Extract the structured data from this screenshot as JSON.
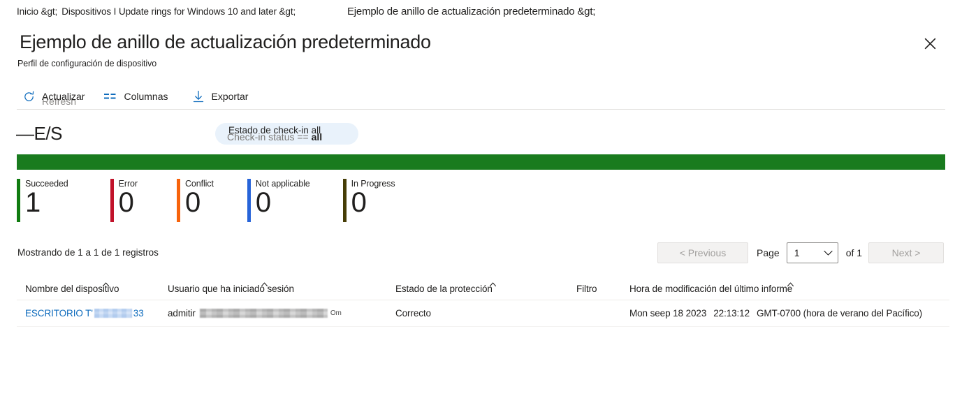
{
  "breadcrumb": {
    "item1": "Inicio &gt;",
    "item2": "Dispositivos I Update rings for Windows 10 and later &gt;",
    "item3": "Ejemplo de anillo de actualización predeterminado &gt;"
  },
  "header": {
    "title": "Ejemplo de anillo de actualización predeterminado",
    "subtitle": "Perfil de configuración de dispositivo",
    "close_icon": "close-icon"
  },
  "toolbar": {
    "refresh_label_es": "Actualizar",
    "refresh_label_en": "Refresh",
    "refresh_icon": "refresh-icon",
    "columns_label": "Columnas",
    "columns_icon": "columns-icon",
    "export_label": "Exportar",
    "export_icon": "download-icon"
  },
  "section": {
    "heading": "—E/S",
    "filter_pill_es": "Estado de check-in all",
    "filter_pill_en_prefix": "Check-in status ==",
    "filter_pill_en_value": "all"
  },
  "status": {
    "bar_color": "#197b1e",
    "tiles": [
      {
        "label": "Succeeded",
        "value": "1",
        "color": "#107c10"
      },
      {
        "label": "Error",
        "value": "0",
        "color": "#c1122a"
      },
      {
        "label": "Conflict",
        "value": "0",
        "color": "#f7630c"
      },
      {
        "label": "Not applicable",
        "value": "0",
        "color": "#2764d9"
      },
      {
        "label": "In Progress",
        "value": "0",
        "color": "#463d06"
      }
    ]
  },
  "records": {
    "showing_text": "Mostrando de 1 a 1 de 1 registros"
  },
  "pagination": {
    "previous_label": "< Previous",
    "page_label": "Page",
    "page_value": "1",
    "of_label": "of 1",
    "next_label": "Next >",
    "chevron_icon": "chevron-down-icon"
  },
  "table": {
    "columns": [
      "Nombre del dispositivo",
      "Usuario que ha iniciado sesión",
      "Estado de la protección",
      "Filtro",
      "Hora de modificación del último informe"
    ],
    "rows": [
      {
        "device_prefix": "ESCRITORIO T'",
        "device_suffix": "33",
        "user_prefix": "admitir",
        "user_suffix": "Om",
        "protection_status": "Correcto",
        "filter": "",
        "report_date": "Mon seep 18 2023",
        "report_time": "22:13:12",
        "report_zone": "GMT-0700 (hora de verano del Pacífico)"
      }
    ]
  },
  "colors": {
    "accent_link": "#0f6cbd",
    "pill_background": "#e9f2fb",
    "divider": "#e1dfdd"
  }
}
